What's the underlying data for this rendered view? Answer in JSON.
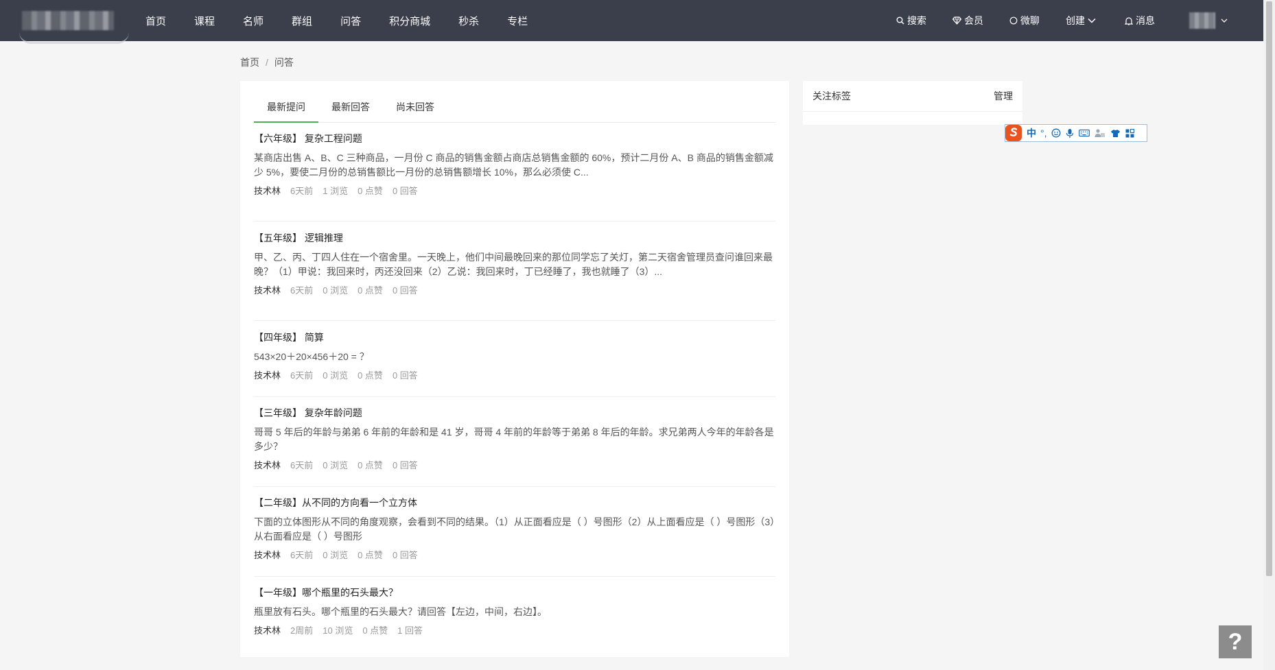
{
  "nav": {
    "items": [
      "首页",
      "课程",
      "名师",
      "群组",
      "问答",
      "积分商城",
      "秒杀",
      "专栏"
    ],
    "right": {
      "search": "搜索",
      "vip": "会员",
      "chat": "微聊",
      "create": "创建",
      "messages": "消息"
    }
  },
  "breadcrumb": {
    "home": "首页",
    "separator": "/",
    "current": "问答"
  },
  "tabs": [
    "最新提问",
    "最新回答",
    "尚未回答"
  ],
  "active_tab": 0,
  "questions": [
    {
      "title": "【六年级】 复杂工程问题",
      "desc": "某商店出售 A、B、C 三种商品，一月份 C 商品的销售金额占商店总销售金额的 60%，预计二月份 A、B 商品的销售金额减少 5%，要使二月份的总销售额比一月份的总销售额增长 10%，那么必须使 C...",
      "author": "技术林",
      "time": "6天前",
      "views": "1 浏览",
      "likes": "0 点赞",
      "answers": "0 回答"
    },
    {
      "title": "【五年级】 逻辑推理",
      "desc": "甲、乙、丙、丁四人住在一个宿舍里。一天晚上，他们中间最晚回来的那位同学忘了关灯，第二天宿舍管理员查问谁回来最晚？（1）甲说：我回来时，丙还没回来（2）乙说：我回来时，丁已经睡了，我也就睡了（3）...",
      "author": "技术林",
      "time": "6天前",
      "views": "0 浏览",
      "likes": "0 点赞",
      "answers": "0 回答"
    },
    {
      "title": "【四年级】 简算",
      "desc": "543×20＋20×456＋20 = ？",
      "author": "技术林",
      "time": "6天前",
      "views": "0 浏览",
      "likes": "0 点赞",
      "answers": "0 回答"
    },
    {
      "title": "【三年级】 复杂年龄问题",
      "desc": "哥哥 5 年后的年龄与弟弟 6 年前的年龄和是 41 岁，哥哥 4 年前的年龄等于弟弟 8 年后的年龄。求兄弟两人今年的年龄各是多少？",
      "author": "技术林",
      "time": "6天前",
      "views": "0 浏览",
      "likes": "0 点赞",
      "answers": "0 回答"
    },
    {
      "title": "【二年级】从不同的方向看一个立方体",
      "desc": "下面的立体图形从不同的角度观察，会看到不同的结果。（1）从正面看应是（ ）号图形（2）从上面看应是（ ）号图形（3）从右面看应是（ ）号图形",
      "author": "技术林",
      "time": "6天前",
      "views": "0 浏览",
      "likes": "0 点赞",
      "answers": "0 回答"
    },
    {
      "title": "【一年级】哪个瓶里的石头最大？",
      "desc": "瓶里放有石头。哪个瓶里的石头最大？请回答【左边，中间，右边】。",
      "author": "技术林",
      "time": "2周前",
      "views": "10 浏览",
      "likes": "0 点赞",
      "answers": "1 回答"
    }
  ],
  "sidebar": {
    "title": "关注标签",
    "manage": "管理"
  },
  "ime": {
    "lang": "中",
    "punct": "°,"
  },
  "help": {
    "label": "?"
  },
  "colors": {
    "topbar": "#3a3f4b",
    "accent": "#4caf50",
    "background": "#f5f5f5"
  }
}
